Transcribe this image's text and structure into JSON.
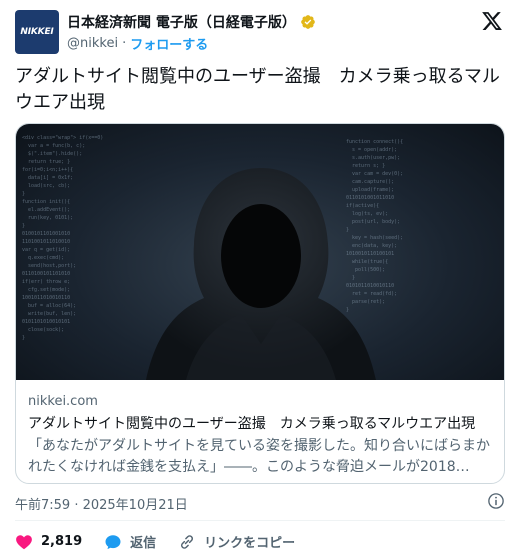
{
  "account": {
    "avatar_text": "NIKKEI",
    "display_name": "日本経済新聞 電子版（日経電子版）",
    "handle": "@nikkei",
    "separator": "·",
    "follow_label": "フォローする",
    "verified_color": "#e2b719"
  },
  "tweet": {
    "text": "アダルトサイト閲覧中のユーザー盗撮　カメラ乗っ取るマルウエア出現"
  },
  "link_card": {
    "domain": "nikkei.com",
    "title": "アダルトサイト閲覧中のユーザー盗撮　カメラ乗っ取るマルウエア出現",
    "description": "「あなたがアダルトサイトを見ている姿を撮影した。知り合いにばらまかれたくなければ金銭を支払え」――。このような脅迫メールが2018…",
    "image_icon": "hooded-hacker-image"
  },
  "meta": {
    "timestamp": "午前7:59 · 2025年10月21日"
  },
  "actions": {
    "like_count": "2,819",
    "reply_label": "返信",
    "copy_link_label": "リンクをコピー"
  },
  "colors": {
    "accent": "#1d9bf0",
    "like": "#f91880",
    "brand_avatar": "#1c3b6e"
  }
}
